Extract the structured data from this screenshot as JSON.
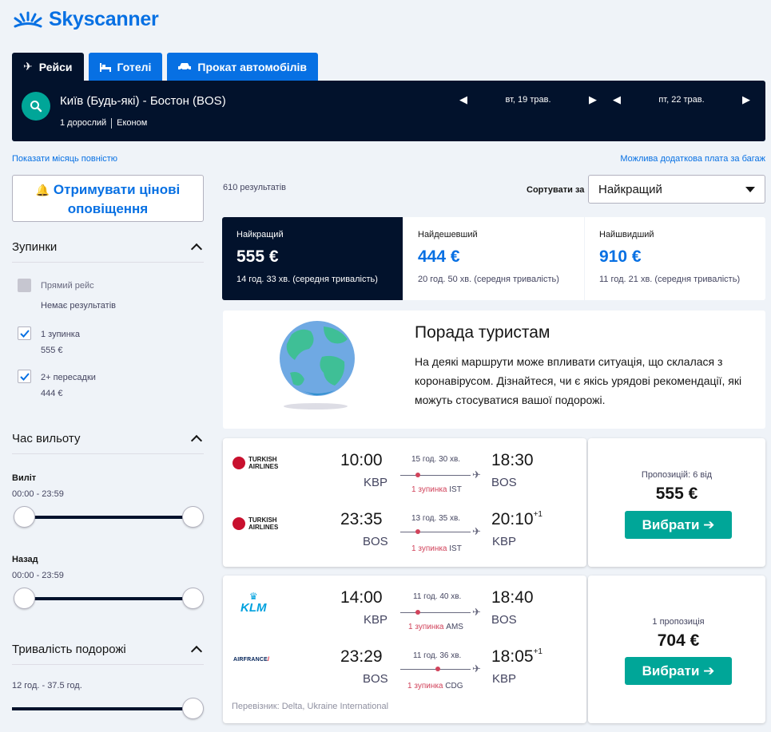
{
  "brand": {
    "name": "Skyscanner",
    "color": "#0770e3"
  },
  "tabs": [
    {
      "label": "Рейси",
      "icon": "plane-icon"
    },
    {
      "label": "Готелі",
      "icon": "bed-icon"
    },
    {
      "label": "Прокат автомобілів",
      "icon": "car-icon"
    }
  ],
  "search": {
    "route": "Київ (Будь-які) - Бостон (BOS)",
    "passengers": "1 дорослий",
    "cabin": "Економ",
    "depart_date": "вт, 19 трав.",
    "return_date": "пт, 22 трав."
  },
  "links": {
    "show_month": "Показати місяць повністю",
    "baggage_fee": "Можлива додаткова плата за багаж"
  },
  "sidebar": {
    "alert_button": "Отримувати цінові оповіщення",
    "stops_title": "Зупинки",
    "stops": [
      {
        "label": "Прямий рейс",
        "sub": "Немає результатів",
        "checked": false,
        "disabled": true
      },
      {
        "label": "1 зупинка",
        "sub": "555 €",
        "checked": true,
        "disabled": false
      },
      {
        "label": "2+ пересадки",
        "sub": "444 €",
        "checked": true,
        "disabled": false
      }
    ],
    "departure_title": "Час вильоту",
    "outbound_label": "Виліт",
    "outbound_range": "00:00 - 23:59",
    "return_label": "Назад",
    "return_range": "00:00 - 23:59",
    "duration_title": "Тривалість подорожі",
    "duration_range": "12 год. - 37.5 год."
  },
  "results": {
    "count": "610 результатів",
    "sort_label": "Сортувати за",
    "sort_value": "Найкращий"
  },
  "sort_tabs": [
    {
      "title": "Найкращий",
      "price": "555 €",
      "detail": "14 год. 33 хв. (середня тривалість)"
    },
    {
      "title": "Найдешевший",
      "price": "444 €",
      "detail": "20 год. 50 хв. (середня тривалість)"
    },
    {
      "title": "Найшвидший",
      "price": "910 €",
      "detail": "11 год. 21 хв. (середня тривалість)"
    }
  ],
  "tip": {
    "title": "Порада туристам",
    "text": "На деякі маршрути може впливати ситуація, що склалася з коронавірусом. Дізнайтеся, чи є якісь урядові рекомендації, які можуть стосуватися вашої подорожі."
  },
  "offers": [
    {
      "legs": [
        {
          "airline": "TURKISH AIRLINES",
          "dep_time": "10:00",
          "dep_code": "KBP",
          "duration": "15 год. 30 хв.",
          "stops": "1 зупинка",
          "via": "IST",
          "arr_time": "18:30",
          "arr_code": "BOS",
          "plus": ""
        },
        {
          "airline": "TURKISH AIRLINES",
          "dep_time": "23:35",
          "dep_code": "BOS",
          "duration": "13 год. 35 хв.",
          "stops": "1 зупинка",
          "via": "IST",
          "arr_time": "20:10",
          "arr_code": "KBP",
          "plus": "+1"
        }
      ],
      "offers_label": "Пропозицій: 6 від",
      "price": "555 €",
      "button": "Вибрати ➔",
      "carrier": ""
    },
    {
      "legs": [
        {
          "airline": "KLM",
          "dep_time": "14:00",
          "dep_code": "KBP",
          "duration": "11 год. 40 хв.",
          "stops": "1 зупинка",
          "via": "AMS",
          "arr_time": "18:40",
          "arr_code": "BOS",
          "plus": ""
        },
        {
          "airline": "AIRFRANCE",
          "dep_time": "23:29",
          "dep_code": "BOS",
          "duration": "11 год. 36 хв.",
          "stops": "1 зупинка",
          "via": "CDG",
          "arr_time": "18:05",
          "arr_code": "KBP",
          "plus": "+1"
        }
      ],
      "offers_label": "1 пропозиція",
      "price": "704 €",
      "button": "Вибрати ➔",
      "carrier": "Перевізник: Delta, Ukraine International"
    }
  ]
}
